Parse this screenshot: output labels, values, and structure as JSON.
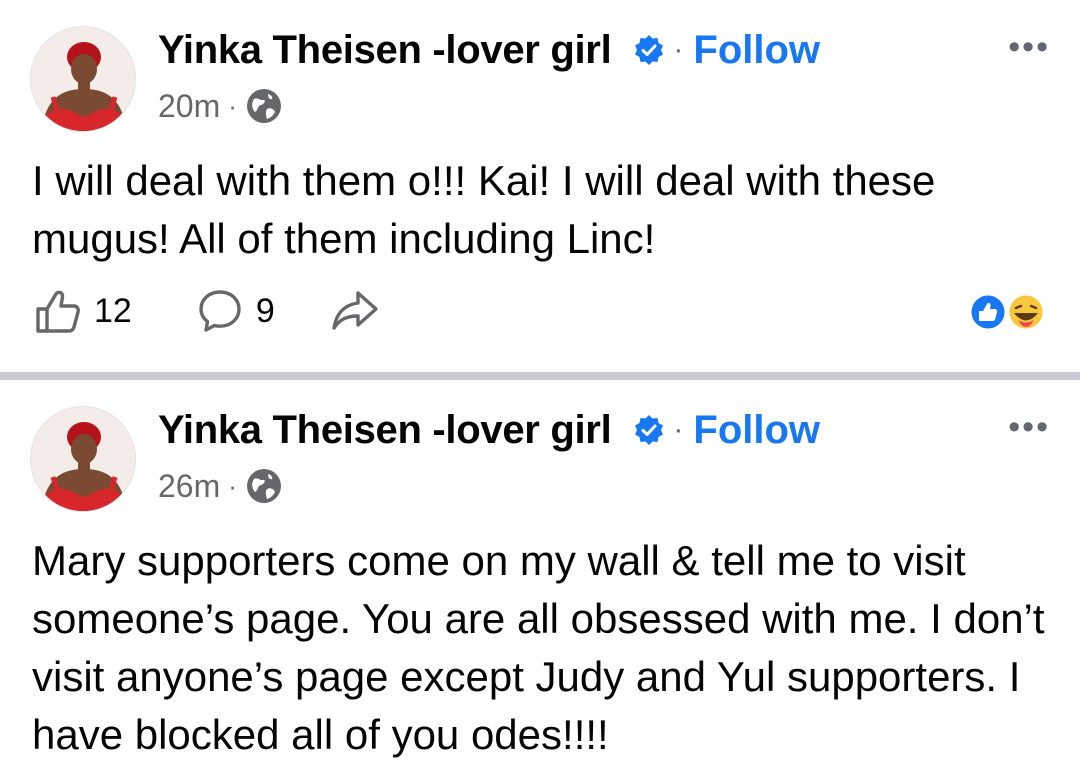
{
  "posts": [
    {
      "author": "Yinka Theisen -lover girl",
      "separator": "·",
      "follow_label": "Follow",
      "more_label": "•••",
      "time": "20m",
      "meta_separator": "·",
      "text": "I will deal with them o!!! Kai! I will deal with these mugus! All of them including Linc!",
      "like_count": "12",
      "comment_count": "9",
      "reaction_icons": [
        "like-reaction-icon",
        "haha-reaction-icon"
      ]
    },
    {
      "author": "Yinka Theisen -lover girl",
      "separator": "·",
      "follow_label": "Follow",
      "more_label": "•••",
      "time": "26m",
      "meta_separator": "·",
      "text": "Mary supporters come on my wall & tell me to visit someone’s page. You are all obsessed with me. I don’t visit anyone’s page except Judy and Yul supporters. I have blocked all of you odes!!!!"
    }
  ],
  "colors": {
    "follow_blue": "#1877f2",
    "secondary_text": "#65676b",
    "divider": "#c9ccd1",
    "avatar_dress_red": "#d7262c"
  }
}
